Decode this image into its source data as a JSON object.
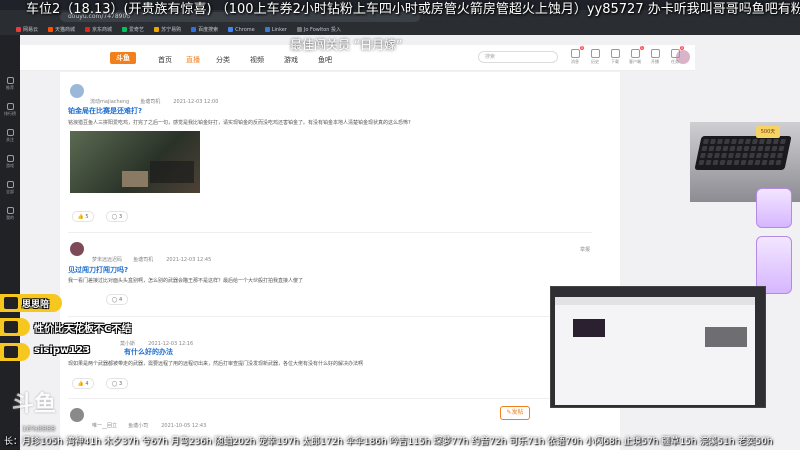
{
  "stream": {
    "ticker_top": "车位2（18.13）(开贵族有惊喜) （100上车券2小时钻粉上车四小时或房管火箭房管超火上蚀月）yy85727 办卡听我叫哥哥吗鱼吧有粉丝",
    "ticker_sub": "最佳闯关员 “日月嫁”",
    "ticker_bottom": "长：月珍105h 湾神41h 木夕37h 兮67h 月弯236h 随蛐202h 宠幸197h 太郎172h 伞伞186h 吟吉115h 琛萝77h 约音72h 可乐71h 依语70h 小闪68h 止境57h 疆草15h 浣溪51h 老奕50h",
    "yellow_tags": [
      "思思陪",
      "性价比天花板不C不结",
      "sisipw123"
    ],
    "brand": "斗鱼",
    "view_count": "16%8888",
    "webcam_caption": "500天"
  },
  "browser": {
    "url": "douyu.com/7478906",
    "bookmarks": [
      "网易云",
      "天猫商城",
      "京东商城",
      "爱奇艺",
      "苏宁易购",
      "百度搜索",
      "Chrome",
      "Linker",
      "Jo Fowlton 投入"
    ],
    "colors": [
      "#e33d3d",
      "#ff5000",
      "#e1251b",
      "#00c15c",
      "#f0a500",
      "#2f6fe1",
      "#4285f4",
      "#3a7bd5",
      "#777777"
    ]
  },
  "sidebar": {
    "items": [
      "推荐",
      "排行榜",
      "关注",
      "游戏",
      "全部",
      "我的"
    ]
  },
  "site_nav": {
    "logo": "斗鱼",
    "links": [
      "首页",
      "直播",
      "分类",
      "视频",
      "游戏",
      "鱼吧"
    ],
    "search_placeholder": "搜索",
    "icons": [
      {
        "label": "消息",
        "badge": "3"
      },
      {
        "label": "历史",
        "badge": ""
      },
      {
        "label": "下载",
        "badge": ""
      },
      {
        "label": "客户端",
        "badge": "1"
      },
      {
        "label": "开播",
        "badge": ""
      },
      {
        "label": "任务",
        "badge": "3"
      }
    ]
  },
  "posts": [
    {
      "author": "流动majiacheng",
      "role": "鱼塘司机",
      "time": "2021-12-03 12:00",
      "title": "铂金局在比赛是还难打?",
      "body": "铭浪猎豆鱼人三拼阳爱吃鸡，打完了之后一句，感觉是我比铂金好打，请实现铂金的反而没吃鸡还害铂金了。有没有铂金本地人清楚铂金现状真的这么恐怖?",
      "likes": "5",
      "comments": "3"
    },
    {
      "author": "梦未远远迟码",
      "role": "鱼塘司机",
      "time": "2021-12-03 12:45",
      "title": "见过闯刀打闯刀吗?",
      "body": "我一看门差接过比对面头头盒别啊，怎么别的武器会瞄王那不是这样？最后给一个大伙般打拍我直接人傻了",
      "likes": "4",
      "comments": "4",
      "report": "举报"
    },
    {
      "author": "莫小斯",
      "role": "",
      "time": "2021-12-03 12:16",
      "title": "有什么好的办法",
      "body": "现如果是两个武器都被带走的武器，需要远程了用的远程切出来，然后打审查提门没发现新武器，各位大佬有没有什么好的解决办法啊",
      "likes": "4",
      "comments": "3"
    },
    {
      "author": "唯一__回立",
      "role": "鱼塘小司",
      "time": "2021-10-05 12:43",
      "post_button": "发帖"
    }
  ]
}
